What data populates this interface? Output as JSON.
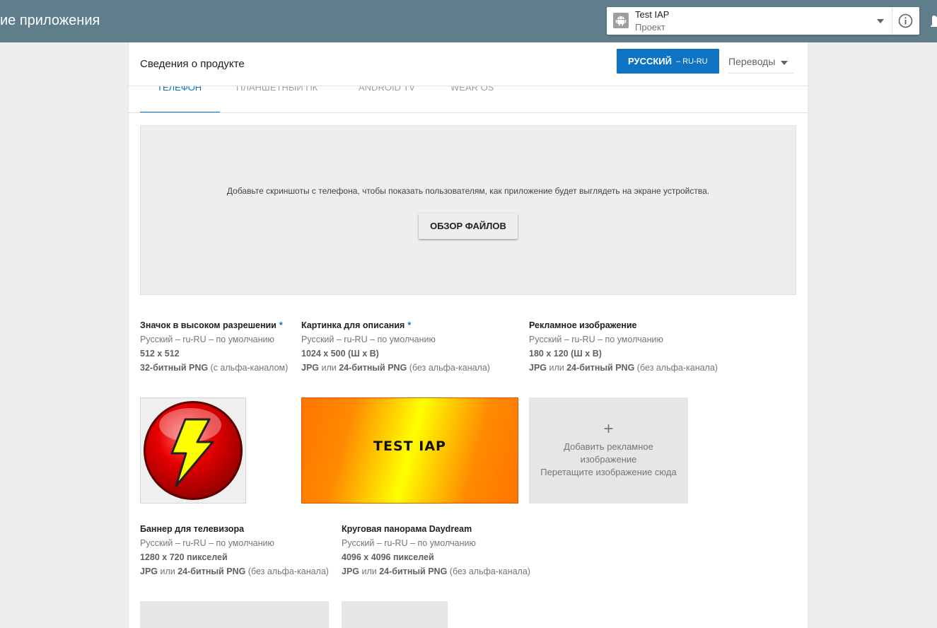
{
  "topbar": {
    "title": "ие приложения"
  },
  "app_selector": {
    "name": "Test IAP",
    "subtitle": "Проект"
  },
  "card": {
    "heading": "Сведения о продукте",
    "language_button": {
      "main": "РУССКИЙ",
      "code": "– RU-RU"
    },
    "translations": "Переводы"
  },
  "tabs": [
    "ТЕЛЕФОН",
    "ПЛАНШЕТНЫЙ ПК",
    "ANDROID TV",
    "WEAR OS"
  ],
  "dropzone": {
    "text": "Добавьте скриншоты с телефона, чтобы показать пользователям, как приложение будет выглядеть на экране устройства.",
    "button": "ОБЗОР ФАЙЛОВ"
  },
  "assets": {
    "icon": {
      "title": "Значок в высоком разрешении",
      "required": "*",
      "lang": "Русский – ru-RU – по умолчанию",
      "size": "512 x 512",
      "fmt_bold": "32-битный PNG",
      "fmt_rest": " (с альфа-каналом)"
    },
    "feature": {
      "title": "Картинка для описания",
      "required": "*",
      "lang": "Русский – ru-RU – по умолчанию",
      "size": "1024 x 500 (Ш x В)",
      "fmt_b1": "JPG",
      "fmt_mid": " или ",
      "fmt_b2": "24-битный PNG",
      "fmt_rest": " (без альфа-канала)"
    },
    "promo": {
      "title": "Рекламное изображение",
      "lang": "Русский – ru-RU – по умолчанию",
      "size": "180 x 120 (Ш x В)",
      "fmt_b1": "JPG",
      "fmt_mid": " или ",
      "fmt_b2": "24-битный PNG",
      "fmt_rest": " (без альфа-канала)"
    },
    "tv": {
      "title": "Баннер для телевизора",
      "lang": "Русский – ru-RU – по умолчанию",
      "size": "1280 x 720 пикселей",
      "fmt_b1": "JPG",
      "fmt_mid": " или ",
      "fmt_b2": "24-битный PNG",
      "fmt_rest": " (без альфа-канала)"
    },
    "pano": {
      "title": "Круговая панорама Daydream",
      "lang": "Русский – ru-RU – по умолчанию",
      "size": "4096 x 4096 пикселей",
      "fmt_b1": "JPG",
      "fmt_mid": " или ",
      "fmt_b2": "24-битный PNG",
      "fmt_rest": " (без альфа-канала)"
    }
  },
  "feature_graphic_text": "TEST IAP",
  "promo_drop": {
    "plus": "+",
    "line1": "Добавить рекламное",
    "line2": "изображение",
    "line3": "Перетащите изображение сюда"
  },
  "colors": {
    "topbar": "#607d8b",
    "accent": "#0e73c2",
    "feature_orange": "#ff7500",
    "feature_yellow": "#ffff00",
    "icon_red": "#e00000"
  }
}
